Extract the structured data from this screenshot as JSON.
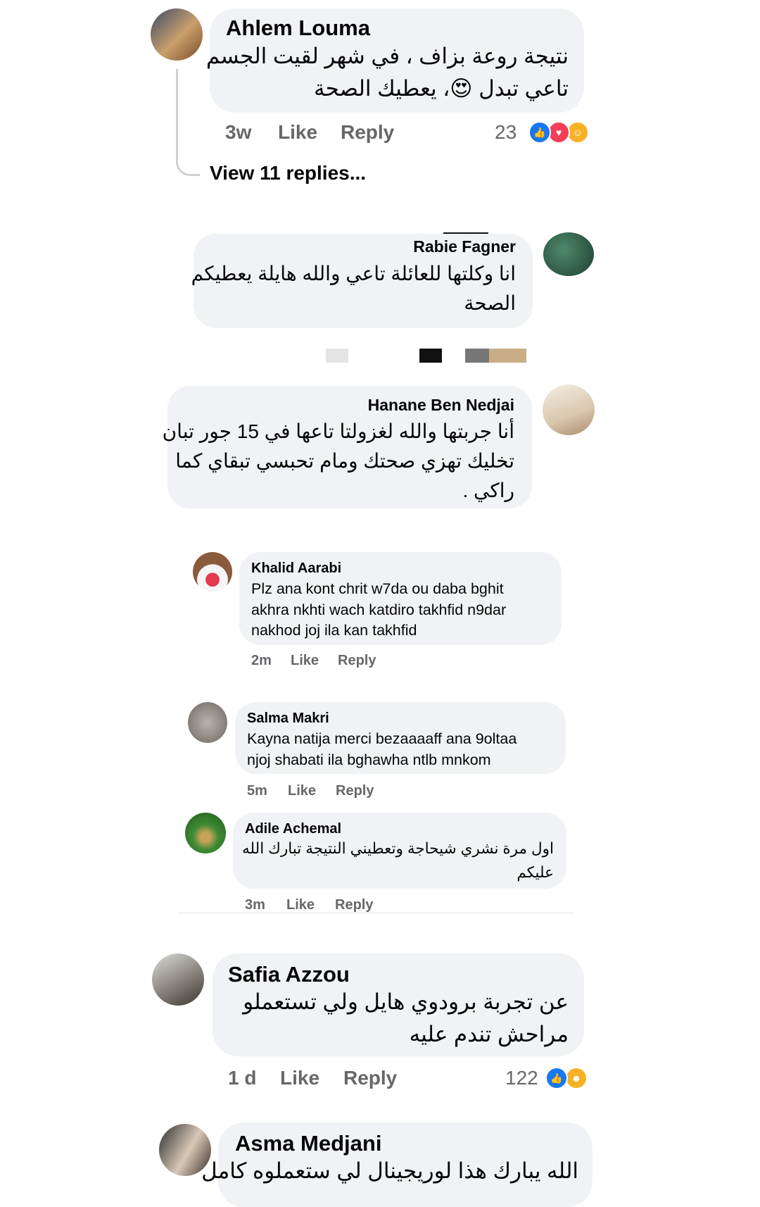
{
  "comments": [
    {
      "author": "Ahlem Louma",
      "lines": [
        "نتيجة روعة بزاف ، في شهر لقيت الجسم",
        "تاعي تبدل 😍، يعطيك الصحة"
      ],
      "time": "3w",
      "like": "Like",
      "reply": "Reply",
      "reaction_count": "23",
      "view_replies": "View 11 replies..."
    },
    {
      "author": "Rabie Fagner",
      "lines": [
        "انا وكلتها للعائلة تاعي والله هايلة يعطيكم",
        "الصحة"
      ]
    },
    {
      "author": "Hanane Ben Nedjai",
      "lines": [
        "أنا جربتها والله لغزولتا تاعها في 15 جور تبان",
        "تخليك تهزي صحتك ومام تحبسي تبقاي كما",
        "راكي ."
      ]
    },
    {
      "author": "Khalid Aarabi",
      "lines": [
        "Plz ana kont chrit w7da ou daba bghit",
        "akhra nkhti wach katdiro takhfid n9dar",
        "nakhod joj ila kan takhfid"
      ],
      "time": "2m",
      "like": "Like",
      "reply": "Reply"
    },
    {
      "author": "Salma Makri",
      "lines": [
        "Kayna natija merci bezaaaaff ana 9oltaa",
        "njoj shabati ila bghawha ntlb mnkom"
      ],
      "time": "5m",
      "like": "Like",
      "reply": "Reply"
    },
    {
      "author": "Adile Achemal",
      "lines": [
        "اول مرة نشري شيحاجة وتعطيني النتيجة تبارك الله",
        "عليكم"
      ],
      "time": "3m",
      "like": "Like",
      "reply": "Reply"
    },
    {
      "author": "Safia Azzou",
      "lines": [
        "عن تجربة برودوي هايل ولي تستعملو",
        "مراحش تندم عليه"
      ],
      "time": "1 d",
      "like": "Like",
      "reply": "Reply",
      "reaction_count": "122"
    },
    {
      "author": "Asma Medjani",
      "lines": [
        "الله يبارك هذا لوريجينال لي ستعملوه كامل"
      ]
    }
  ],
  "colors": {
    "bubble": "#f0f2f5",
    "meta": "#65676b",
    "like_reaction": "#1877f2",
    "love_reaction": "#f33e58",
    "care_reaction": "#f7b125"
  },
  "icons": [
    "like-reaction-icon",
    "love-reaction-icon",
    "care-reaction-icon",
    "haha-reaction-icon"
  ]
}
